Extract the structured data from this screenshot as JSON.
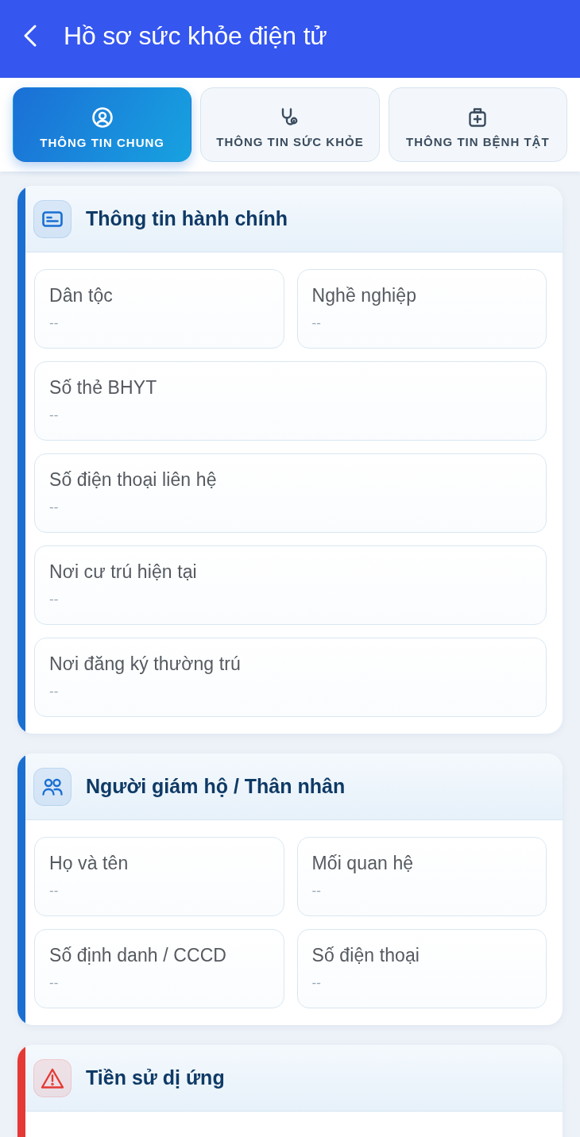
{
  "header": {
    "title": "Hồ sơ sức khỏe điện tử"
  },
  "tabs": [
    {
      "kind": "general",
      "label": "THÔNG TIN CHUNG",
      "selected": true
    },
    {
      "kind": "health",
      "label": "THÔNG TIN SỨC KHỎE",
      "selected": false
    },
    {
      "kind": "disease",
      "label": "THÔNG TIN BỆNH TẬT",
      "selected": false
    }
  ],
  "sections": [
    {
      "kind": "administrative",
      "title": "Thông tin hành chính",
      "color": "#1a6fd1",
      "rows": [
        [
          {
            "label": "Dân tộc",
            "value": "--"
          },
          {
            "label": "Nghề nghiệp",
            "value": "--"
          }
        ],
        [
          {
            "label": "Số thẻ BHYT",
            "value": "--"
          }
        ],
        [
          {
            "label": "Số điện thoại liên hệ",
            "value": "--"
          }
        ],
        [
          {
            "label": "Nơi cư trú hiện tại",
            "value": "--"
          }
        ],
        [
          {
            "label": "Nơi đăng ký thường trú",
            "value": "--"
          }
        ]
      ]
    },
    {
      "kind": "guardian",
      "title": "Người giám hộ / Thân nhân",
      "color": "#1a6fd1",
      "rows": [
        [
          {
            "label": "Họ và tên",
            "value": "--"
          },
          {
            "label": "Mối quan hệ",
            "value": "--"
          }
        ],
        [
          {
            "label": "Số định danh / CCCD",
            "value": "--"
          },
          {
            "label": "Số điện thoại",
            "value": "--"
          }
        ]
      ]
    },
    {
      "kind": "allergy",
      "title": "Tiền sử dị ứng",
      "color": "#e53935"
    }
  ]
}
